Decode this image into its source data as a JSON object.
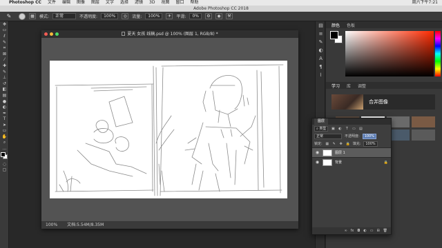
{
  "menubar": {
    "apple": "",
    "app": "Photoshop CC",
    "items": [
      "文件",
      "编辑",
      "图像",
      "图层",
      "文字",
      "选择",
      "滤镜",
      "3D",
      "视图",
      "窗口",
      "帮助"
    ],
    "right": [
      "",
      "周六下午7:21"
    ]
  },
  "title": "Adobe Photoshop CC 2018",
  "options": {
    "mode_label": "模式:",
    "mode_value": "正常",
    "opacity_label": "不透明度:",
    "opacity_value": "100%",
    "flow_label": "流量:",
    "flow_value": "100%",
    "smooth_label": "平滑:",
    "smooth_value": "0%"
  },
  "document": {
    "title": "夏天 女孩 线稿.psd @ 100% (图层 1, RGB/8) *",
    "zoom": "100%",
    "doc_size": "文档:5.54M/8.35M"
  },
  "color_panel": {
    "tabs": [
      "颜色",
      "色板"
    ],
    "active": 0
  },
  "learn_panel": {
    "tabs": [
      "学习",
      "库",
      "调整"
    ],
    "active": 0,
    "hero": "合并图像"
  },
  "layers": {
    "tab": "图层",
    "kind_label": "类型",
    "blend": "正常",
    "opacity_label": "不透明度:",
    "opacity_value": "100%",
    "lock_label": "锁定:",
    "fill_label": "填充:",
    "fill_value": "100%",
    "items": [
      {
        "name": "图层 1",
        "selected": true
      },
      {
        "name": "背景",
        "selected": false
      }
    ]
  },
  "accent": "#5b7bb1"
}
